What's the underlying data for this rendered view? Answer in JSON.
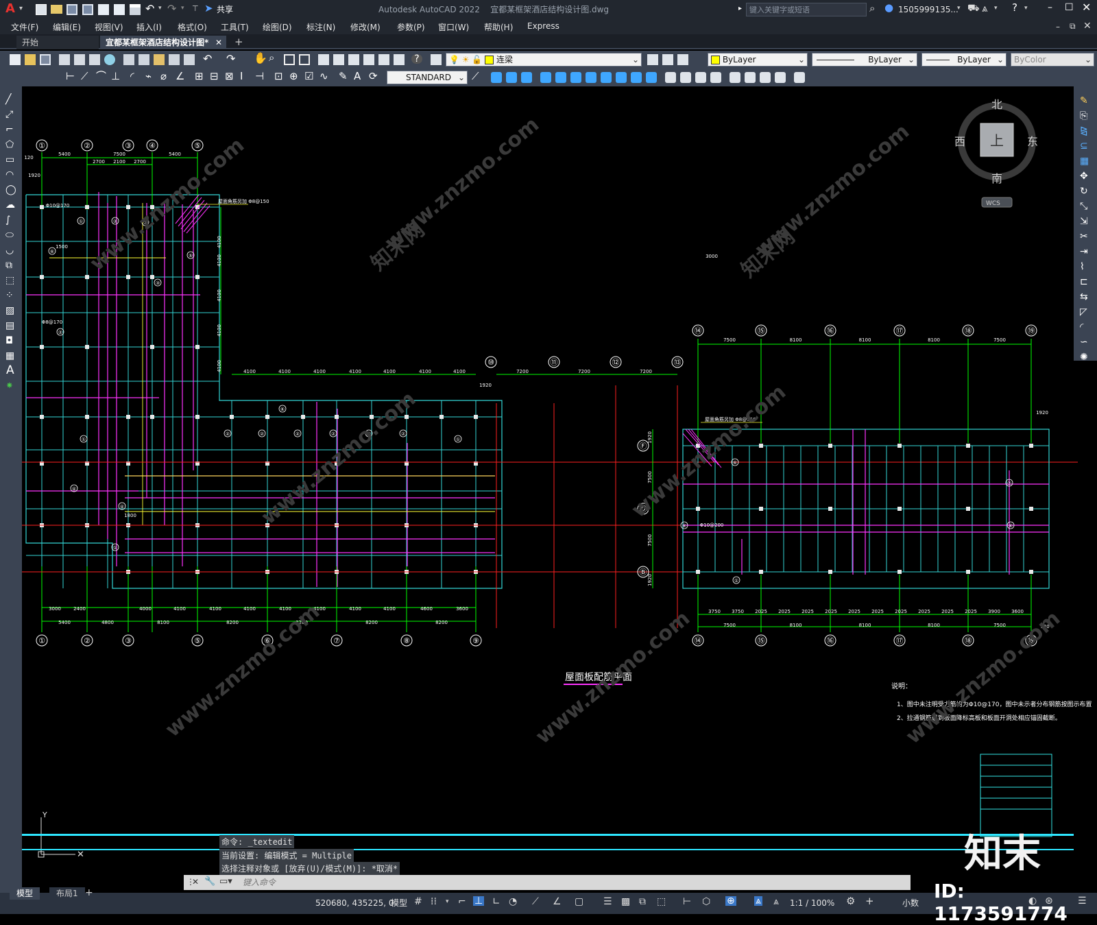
{
  "app": {
    "title": "Autodesk AutoCAD 2022",
    "filename": "宜都某框架酒店结构设计图.dwg",
    "share": "共享",
    "search_placeholder": "键入关键字或短语",
    "user": "1505999135...",
    "logo": "A"
  },
  "menu": [
    "文件(F)",
    "编辑(E)",
    "视图(V)",
    "插入(I)",
    "格式(O)",
    "工具(T)",
    "绘图(D)",
    "标注(N)",
    "修改(M)",
    "参数(P)",
    "窗口(W)",
    "帮助(H)",
    "Express"
  ],
  "tabs": [
    {
      "label": "开始",
      "active": false
    },
    {
      "label": "宜都某框架酒店结构设计图*",
      "active": true
    }
  ],
  "toolbar": {
    "layer": "连梁",
    "color": "ByLayer",
    "linetype": "ByLayer",
    "lineweight": "ByLayer",
    "plotstyle": "ByColor",
    "textstyle": "STANDARD"
  },
  "viewcube": {
    "north": "北",
    "south": "南",
    "east": "东",
    "west": "西",
    "top": "上",
    "wcs": "WCS"
  },
  "drawing": {
    "title": "屋面板配筋平面",
    "notes_title": "说明：",
    "notes": [
      "1、图中未注明受力筋均为Φ10@170，图中未示者分布钢筋按图示布置",
      "2、拉通钢筋遇到板面降标高板和板面开洞处相应锚固截断。"
    ],
    "left_grid_top": [
      "①",
      "②",
      "③",
      "④",
      "⑤"
    ],
    "left_grid_bottom": [
      "①",
      "②",
      "③",
      "⑤",
      "⑥",
      "⑦",
      "⑧",
      "⑨"
    ],
    "mid_grid": [
      "⑩",
      "⑪",
      "⑫",
      "⑬"
    ],
    "right_grid": [
      "⑭",
      "⑮",
      "⑯",
      "⑰",
      "⑱",
      "⑲"
    ],
    "right_rows": [
      "Ⓕ",
      "Ⓓ",
      "Ⓑ"
    ],
    "left_top_dims": [
      "5400",
      "7500",
      "5400"
    ],
    "left_top_sub": [
      "2700",
      "2100",
      "2700"
    ],
    "left_bottom_dims": [
      "5400",
      "4800",
      "8100",
      "8200",
      "8200",
      "8200",
      "8200"
    ],
    "left_bottom_sub": [
      "3000",
      "2400",
      "4000",
      "4100",
      "4100",
      "4100",
      "4100",
      "4100",
      "4100",
      "4100",
      "4600",
      "3600"
    ],
    "left_side_dims": [
      "4100",
      "4100",
      "4100",
      "4100",
      "4100"
    ],
    "mid_top_dims": [
      "4100",
      "4100",
      "4100",
      "4100",
      "4100",
      "4100",
      "4100"
    ],
    "mid_dims": [
      "7200",
      "7200",
      "7200"
    ],
    "right_top_dims": [
      "7500",
      "8100",
      "8100",
      "8100",
      "7500"
    ],
    "right_bottom_dims": [
      "7500",
      "8100",
      "8100",
      "8100",
      "7500"
    ],
    "right_bottom_sub": [
      "3750",
      "3750",
      "2025",
      "2025",
      "2025",
      "2025",
      "2025",
      "2025",
      "2025",
      "2025",
      "2025",
      "2025",
      "3900",
      "3600"
    ],
    "right_side_dims": [
      "1920",
      "7500",
      "7500",
      "1920"
    ],
    "edge_dims": [
      "120",
      "1920",
      "1920",
      "1920",
      "120"
    ],
    "rebar_note_left": "屋面角筋另加 Φ8@150",
    "rebar_note_right": "屋面角筋另加 Φ8@150",
    "rebar_labels": [
      "Φ8@170",
      "Φ10@170",
      "Φ10@200",
      "3000",
      "1500",
      "1800"
    ],
    "slab_marks": [
      "①",
      "②",
      "③",
      "④",
      "⑤",
      "⑥",
      "⑦"
    ]
  },
  "command": {
    "history": [
      "命令: _textedit",
      "当前设置: 编辑模式 = Multiple",
      "选择注释对象或 [放弃(U)/模式(M)]: *取消*"
    ],
    "placeholder": "键入命令"
  },
  "layout_tabs": [
    "模型",
    "布局1"
  ],
  "status": {
    "coords": "520680, 435225, 0",
    "mode": "模型",
    "scale": "1:1 / 100%",
    "units": "小数"
  },
  "watermark": {
    "text": "www.znzmo.com",
    "brand": "知末",
    "brand_site": "知末网",
    "id": "ID: 1173591774"
  },
  "colors": {
    "grid_green": "#00ff00",
    "beam_cyan": "#33d6d6",
    "rebar_magenta": "#ff33ff",
    "axis_red": "#ff2020",
    "accent_yellow": "#ffff33"
  }
}
